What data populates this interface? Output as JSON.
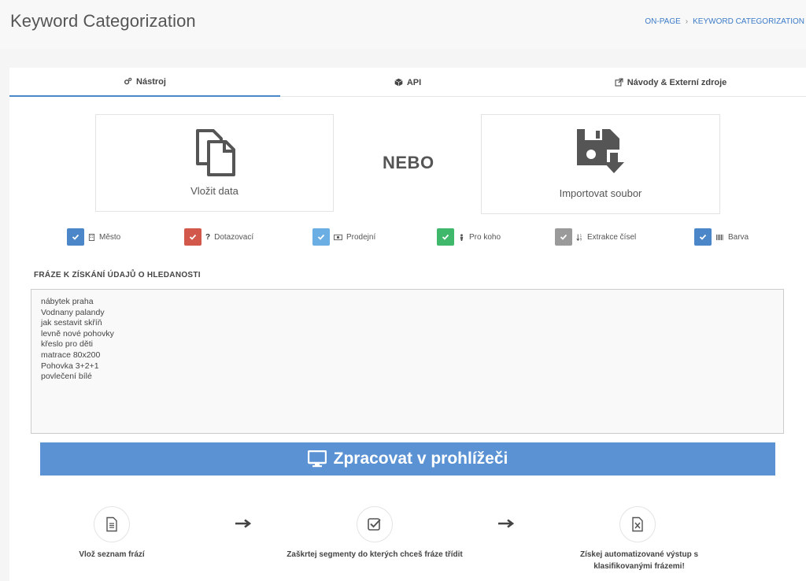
{
  "header": {
    "title": "Keyword Categorization",
    "breadcrumb": [
      "ON-PAGE",
      "KEYWORD CATEGORIZATION"
    ]
  },
  "tabs": [
    {
      "label": "Nástroj",
      "icon": "gears-icon",
      "active": true
    },
    {
      "label": "API",
      "icon": "cube-icon",
      "active": false
    },
    {
      "label": "Návody & Externí zdroje",
      "icon": "external-link-icon",
      "active": false
    }
  ],
  "input_options": {
    "paste_label": "Vložit data",
    "or_label": "NEBO",
    "import_label": "Importovat soubor"
  },
  "segments": [
    {
      "label": "Město",
      "color": "#4a86c8",
      "icon": "building-icon"
    },
    {
      "label": "Dotazovací",
      "color": "#d2584c",
      "icon": "question-icon"
    },
    {
      "label": "Prodejní",
      "color": "#6aaee4",
      "icon": "money-icon"
    },
    {
      "label": "Pro koho",
      "color": "#3fb86b",
      "icon": "person-icon"
    },
    {
      "label": "Extrakce čísel",
      "color": "#9a9a9a",
      "icon": "sort-numeric-icon"
    },
    {
      "label": "Barva",
      "color": "#4a86c8",
      "icon": "barcode-icon"
    }
  ],
  "phrases": {
    "title": "FRÁZE K ZÍSKÁNÍ ÚDAJŮ O HLEDANOSTI",
    "value": "nábytek praha\nVodnany palandy\njak sestavit skříň\nlevně nové pohovky\nkřeslo pro děti\nmatrace 80x200\nPohovka 3+2+1\npovlečení bílé"
  },
  "process_button": {
    "label": "Zpracovat v prohlížeči",
    "color": "#5b92d4"
  },
  "steps": [
    {
      "text": "Vlož seznam frází",
      "icon": "document-icon"
    },
    {
      "text": "Zaškrtej segmenty do kterých chceš fráze třídit",
      "icon": "checkbox-icon"
    },
    {
      "text": "Získej automatizované výstup s klasifikovanými frázemi!",
      "icon": "excel-file-icon"
    }
  ]
}
